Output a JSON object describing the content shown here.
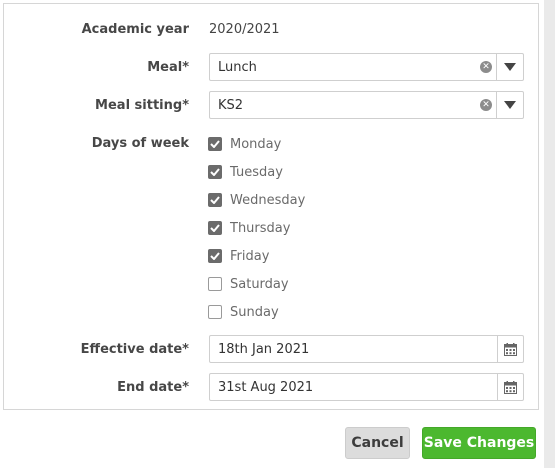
{
  "form": {
    "academic_year": {
      "label": "Academic year",
      "value": "2020/2021"
    },
    "meal": {
      "label": "Meal*",
      "value": "Lunch"
    },
    "meal_sitting": {
      "label": "Meal sitting*",
      "value": "KS2"
    },
    "days_of_week": {
      "label": "Days of week",
      "days": [
        {
          "label": "Monday",
          "checked": true
        },
        {
          "label": "Tuesday",
          "checked": true
        },
        {
          "label": "Wednesday",
          "checked": true
        },
        {
          "label": "Thursday",
          "checked": true
        },
        {
          "label": "Friday",
          "checked": true
        },
        {
          "label": "Saturday",
          "checked": false
        },
        {
          "label": "Sunday",
          "checked": false
        }
      ]
    },
    "effective_date": {
      "label": "Effective date*",
      "value": "18th Jan 2021"
    },
    "end_date": {
      "label": "End date*",
      "value": "31st Aug 2021"
    }
  },
  "actions": {
    "cancel_label": "Cancel",
    "save_label": "Save Changes"
  },
  "colors": {
    "accent_save": "#4cb82f",
    "checkbox_checked": "#6b6b6b"
  },
  "icons": {
    "clear": "clear-circle-x-icon",
    "dropdown": "triangle-down-icon",
    "calendar": "calendar-icon",
    "check": "checkmark-icon"
  }
}
